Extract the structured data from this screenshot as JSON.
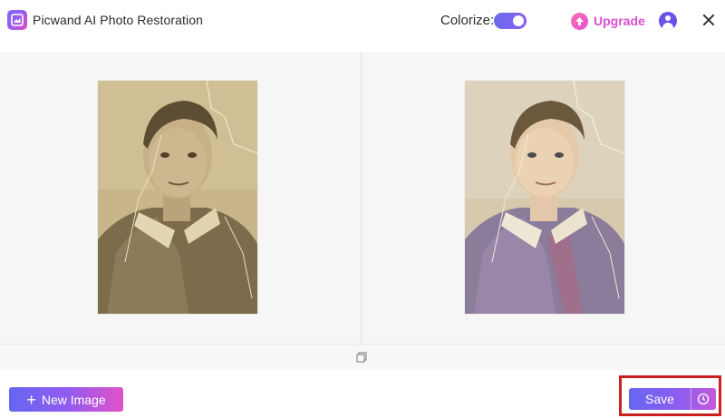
{
  "header": {
    "app_title": "Picwand AI Photo Restoration",
    "colorize_label": "Colorize:",
    "colorize_on": true,
    "upgrade_label": "Upgrade"
  },
  "workspace": {
    "original_photo_icon": "original-photo",
    "restored_photo_icon": "restored-photo",
    "compare_icon": "compare-icon"
  },
  "footer": {
    "new_image_label": "New Image",
    "save_label": "Save"
  },
  "colors": {
    "accent_start": "#6566f0",
    "accent_end": "#e152c8",
    "highlight": "#cc1f1f"
  }
}
